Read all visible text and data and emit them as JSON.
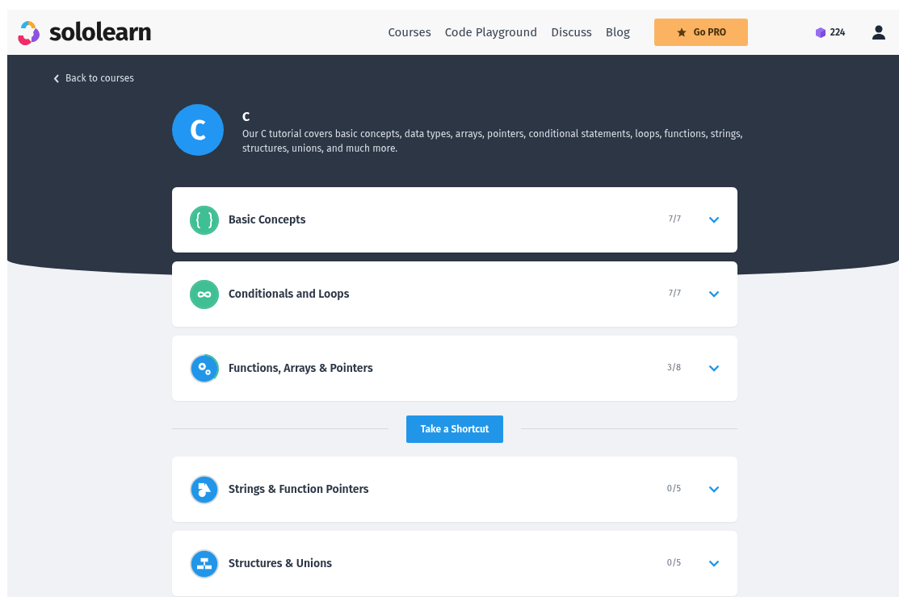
{
  "header": {
    "logo": "sololearn",
    "nav": [
      "Courses",
      "Code Playground",
      "Discuss",
      "Blog"
    ],
    "pro_button": "Go PRO",
    "gems": "224"
  },
  "back_link": "Back to courses",
  "course": {
    "badge": "C",
    "title": "C",
    "description": "Our C tutorial covers basic concepts, data types, arrays, pointers, conditional statements, loops, functions, strings, structures, unions, and much more."
  },
  "modules": [
    {
      "kind": "module",
      "completed": true,
      "title": "Basic Concepts",
      "progress": "7/7"
    },
    {
      "kind": "module",
      "completed": true,
      "title": "Conditionals and Loops",
      "progress": "7/7"
    },
    {
      "kind": "module",
      "completed": false,
      "title": "Functions, Arrays & Pointers",
      "progress": "3/8"
    },
    {
      "kind": "shortcut",
      "label": "Take a Shortcut"
    },
    {
      "kind": "module",
      "completed": false,
      "title": "Strings & Function Pointers",
      "progress": "0/5"
    },
    {
      "kind": "module",
      "completed": false,
      "title": "Structures & Unions",
      "progress": "0/5"
    }
  ]
}
